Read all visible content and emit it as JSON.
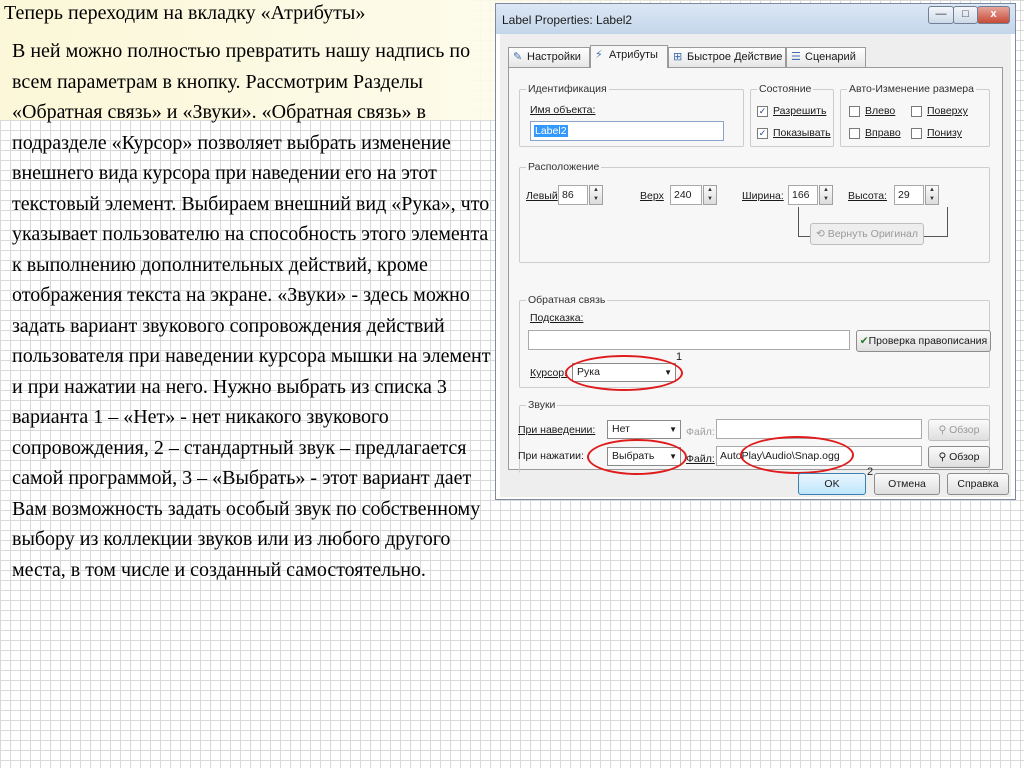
{
  "slide": {
    "title": "Теперь переходим на вкладку «Атрибуты»",
    "body": "В ней можно полностью превратить нашу надпись по всем параметрам в кнопку. Рассмотрим Разделы «Обратная связь» и «Звуки». «Обратная связь» в подразделе «Курсор» позволяет выбрать изменение внешнего вида курсора при наведении его на этот текстовый элемент. Выбираем внешний вид «Рука», что указывает пользователю на способность этого элемента к выполнению дополнительных действий, кроме отображения текста на экране. «Звуки» - здесь можно задать вариант звукового сопровождения действий пользователя при наведении курсора мышки на элемент и при нажатии на него. Нужно выбрать из списка 3 варианта 1 – «Нет» - нет никакого звукового сопровождения, 2 – стандартный звук – предлагается самой программой, 3 – «Выбрать» - этот вариант дает Вам возможность задать особый звук по собственному выбору из коллекции звуков или из любого другого места, в том числе и созданный самостоятельно."
  },
  "dialog": {
    "title": "Label Properties: Label2",
    "window_buttons": {
      "minimize": "—",
      "maximize": "□",
      "close": "x"
    },
    "tabs": [
      {
        "label": "Настройки",
        "icon": "pencil-icon"
      },
      {
        "label": "Атрибуты",
        "icon": "wand-icon",
        "active": true
      },
      {
        "label": "Быстрое Действие",
        "icon": "flow-icon"
      },
      {
        "label": "Сценарий",
        "icon": "script-icon"
      }
    ],
    "identification": {
      "label": "Идентификация",
      "name_label": "Имя объекта:",
      "name_value": "Label2"
    },
    "state": {
      "label": "Состояние",
      "enable": {
        "label": "Разрешить",
        "checked": true
      },
      "show": {
        "label": "Показывать",
        "checked": true
      }
    },
    "autosize": {
      "label": "Авто-Изменение размера",
      "left": "Влево",
      "top": "Поверху",
      "right": "Вправо",
      "bottom": "Понизу"
    },
    "position": {
      "label": "Расположение",
      "left_label": "Левый",
      "left_value": "86",
      "top_label": "Верх",
      "top_value": "240",
      "width_label": "Ширина:",
      "width_value": "166",
      "height_label": "Высота:",
      "height_value": "29",
      "restore_label": "Вернуть Оригинал"
    },
    "feedback": {
      "label": "Обратная связь",
      "tooltip_label": "Подсказка:",
      "tooltip_value": "",
      "spell_label": "Проверка правописания",
      "cursor_label": "Курсор:",
      "cursor_value": "Рука",
      "annotation": "1"
    },
    "sounds": {
      "label": "Звуки",
      "hover_label": "При наведении:",
      "hover_value": "Нет",
      "hover_file_label": "Файл:",
      "hover_file_value": "",
      "click_label": "При нажатии:",
      "click_value": "Выбрать",
      "click_file_label": "Файл:",
      "click_file_value": "AutoPlay\\Audio\\Snap.ogg",
      "browse_label": "Обзор",
      "annotation": "2"
    },
    "buttons": {
      "ok": "OK",
      "cancel": "Отмена",
      "help": "Справка"
    }
  }
}
